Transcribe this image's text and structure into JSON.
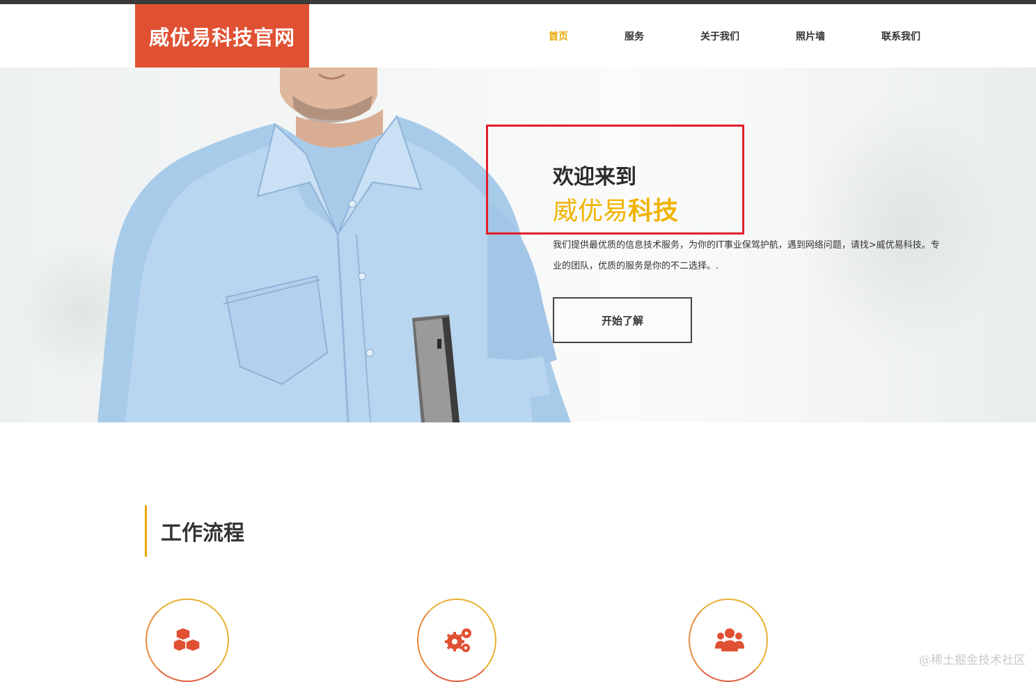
{
  "header": {
    "logo": "威优易科技官网",
    "nav": [
      {
        "label": "首页",
        "active": true
      },
      {
        "label": "服务",
        "active": false
      },
      {
        "label": "关于我们",
        "active": false
      },
      {
        "label": "照片墙",
        "active": false
      },
      {
        "label": "联系我们",
        "active": false
      }
    ]
  },
  "hero": {
    "welcome_line1": "欢迎来到",
    "welcome_line2_normal": "威优易",
    "welcome_line2_bold": "科技",
    "description": "我们提供最优质的信息技术服务，为你的IT事业保驾护航，遇到网络问题，请找>威优易科技。专业的团队，优质的服务是你的不二选择。.",
    "cta_label": "开始了解"
  },
  "workflow": {
    "title": "工作流程",
    "steps": [
      {
        "icon": "cubes-icon"
      },
      {
        "icon": "gears-icon"
      },
      {
        "icon": "users-icon"
      }
    ]
  },
  "watermark": "@稀土掘金技术社区",
  "colors": {
    "brand": "#e05032",
    "accent": "#f0b400",
    "highlight_border": "#e0202a",
    "text": "#333333"
  }
}
